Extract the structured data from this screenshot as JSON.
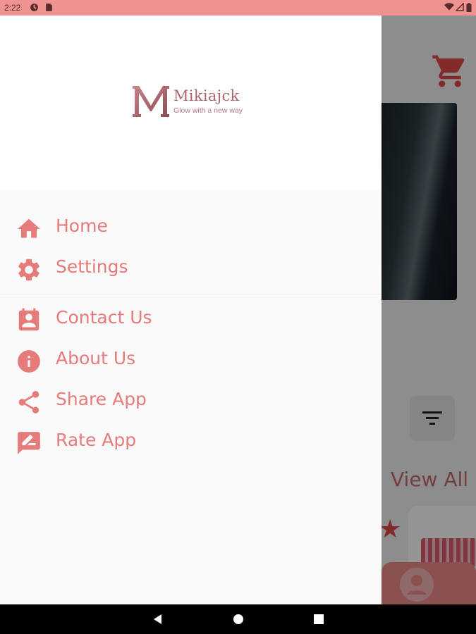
{
  "status_bar": {
    "time": "2:22",
    "icons": [
      "notification-icon",
      "sim-card-icon",
      "wifi-icon",
      "signal-icon",
      "battery-icon"
    ]
  },
  "drawer": {
    "logo": {
      "name": "Mikiajck",
      "tagline": "Glow with a new way"
    },
    "menu": [
      {
        "id": "home",
        "label": "Home",
        "icon": "home-icon"
      },
      {
        "id": "settings",
        "label": "Settings",
        "icon": "gear-icon"
      },
      {
        "id": "contact",
        "label": "Contact Us",
        "icon": "contact-card-icon"
      },
      {
        "id": "about",
        "label": "About Us",
        "icon": "info-icon"
      },
      {
        "id": "share",
        "label": "Share App",
        "icon": "share-icon"
      },
      {
        "id": "rate",
        "label": "Rate App",
        "icon": "rate-review-icon"
      }
    ]
  },
  "background": {
    "view_all": "View All",
    "icons": [
      "cart-icon",
      "filter-icon",
      "star-icon",
      "profile-icon"
    ]
  },
  "navigation": {
    "buttons": [
      "back-button",
      "home-button",
      "recents-button"
    ]
  },
  "colors": {
    "accent": "#e57b7b",
    "status_bar": "#ef9292",
    "drawer_bg": "#fafafa",
    "header_bg": "#ffffff",
    "logo": "#b0646e"
  }
}
